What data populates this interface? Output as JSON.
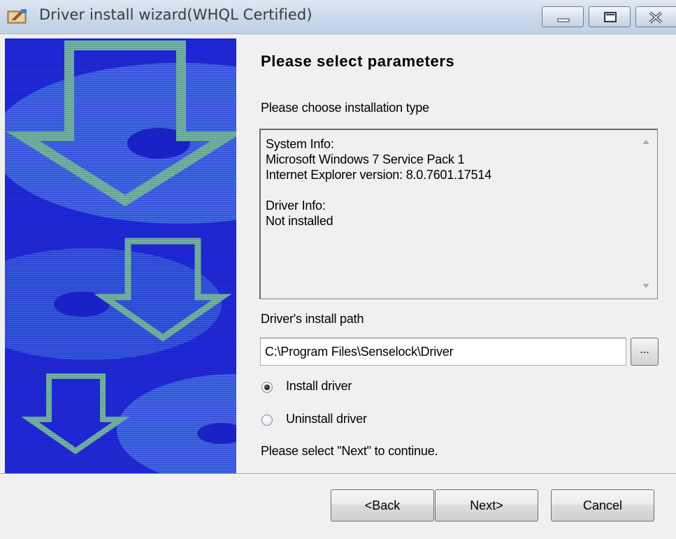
{
  "window": {
    "title": "Driver install wizard(WHQL Certified)",
    "icon": "driver-wizard-icon"
  },
  "page": {
    "heading": "Please select parameters",
    "install_type_label": "Please choose installation type",
    "info_lines": [
      "System Info:",
      "Microsoft Windows 7 Service Pack 1",
      "Internet Explorer version: 8.0.7601.17514",
      "",
      "Driver Info:",
      "Not installed"
    ],
    "path_label": "Driver's install path",
    "path_value": "C:\\Program Files\\Senselock\\Driver",
    "browse_label": "...",
    "radio_install": "Install driver",
    "radio_uninstall": "Uninstall driver",
    "selected_option": "Install driver",
    "continue_hint": "Please select \"Next\" to continue."
  },
  "buttons": {
    "back": "<Back",
    "next": "Next>",
    "cancel": "Cancel"
  },
  "colors": {
    "banner_blue": "#1a23c8",
    "banner_arrow": "#7fb9a8",
    "window_face": "#f0f0f0"
  }
}
